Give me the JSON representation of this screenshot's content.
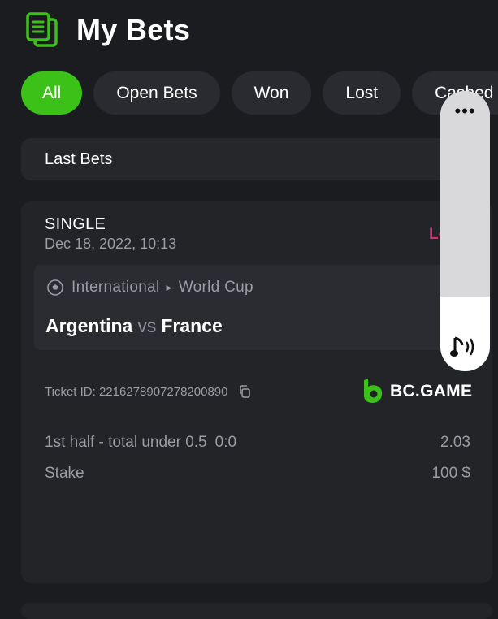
{
  "header": {
    "title": "My Bets",
    "icon": "receipt-icon"
  },
  "filters": [
    {
      "label": "All",
      "active": true
    },
    {
      "label": "Open Bets",
      "active": false
    },
    {
      "label": "Won",
      "active": false
    },
    {
      "label": "Lost",
      "active": false
    },
    {
      "label": "Cashed",
      "active": false
    }
  ],
  "last_bets": {
    "label": "Last Bets"
  },
  "bet": {
    "type": "SINGLE",
    "date": "Dec 18, 2022, 10:13",
    "status": "Lost",
    "league": "International",
    "tournament": "World Cup",
    "team_home": "Argentina",
    "vs": "vs",
    "team_away": "France",
    "ticket_label": "Ticket ID:",
    "ticket_id": "2216278907278200890",
    "brand": "BC.GAME",
    "market": "1st half - total under 0.5",
    "score": "0:0",
    "odds": "2.03",
    "stake_label": "Stake",
    "stake_value": "100 $"
  },
  "overlay": {
    "menu": "•••",
    "icon": "sound-icon"
  },
  "colors": {
    "accent": "#3bc117",
    "status_lost": "#d62d7a",
    "background": "#1b1c1f",
    "card": "#232428"
  }
}
